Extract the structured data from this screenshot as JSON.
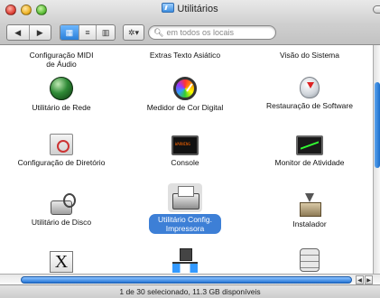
{
  "window": {
    "title": "Utilitários"
  },
  "toolbar": {
    "back_icon": "back-arrow-icon",
    "forward_icon": "forward-arrow-icon",
    "view_icons": [
      "icon-view-icon",
      "list-view-icon",
      "column-view-icon"
    ],
    "action_icon": "gear-icon",
    "search": {
      "placeholder": "em todos os locais",
      "value": ""
    }
  },
  "items": [
    {
      "label": "Configuração MIDI de Áudio",
      "icon": "midi-icon",
      "selected": false
    },
    {
      "label": "Extras Texto Asiático",
      "icon": "asian-text-icon",
      "selected": false
    },
    {
      "label": "Visão do Sistema",
      "icon": "system-profiler-icon",
      "selected": false
    },
    {
      "label": "Utilitário de Rede",
      "icon": "network-utility-icon",
      "selected": false
    },
    {
      "label": "Medidor de Cor Digital",
      "icon": "color-meter-icon",
      "selected": false
    },
    {
      "label": "Restauração de Software",
      "icon": "software-restore-icon",
      "selected": false
    },
    {
      "label": "Configuração de Diretório",
      "icon": "directory-access-icon",
      "selected": false
    },
    {
      "label": "Console",
      "icon": "console-icon",
      "selected": false
    },
    {
      "label": "Monitor de Atividade",
      "icon": "activity-monitor-icon",
      "selected": false
    },
    {
      "label": "Utilitário de Disco",
      "icon": "disk-utility-icon",
      "selected": false
    },
    {
      "label": "Utilitário Config. Impressora",
      "icon": "printer-setup-icon",
      "selected": true
    },
    {
      "label": "Instalador",
      "icon": "installer-icon",
      "selected": false
    },
    {
      "label": "",
      "icon": "x11-icon",
      "selected": false
    },
    {
      "label": "",
      "icon": "netinfo-manager-icon",
      "selected": false
    },
    {
      "label": "",
      "icon": "server-icon",
      "selected": false
    }
  ],
  "status": {
    "text": "1 de 30 selecionado, 11.3 GB disponíveis"
  },
  "colors": {
    "selection": "#3d7fd6",
    "scroll_thumb": "#2676d6"
  }
}
